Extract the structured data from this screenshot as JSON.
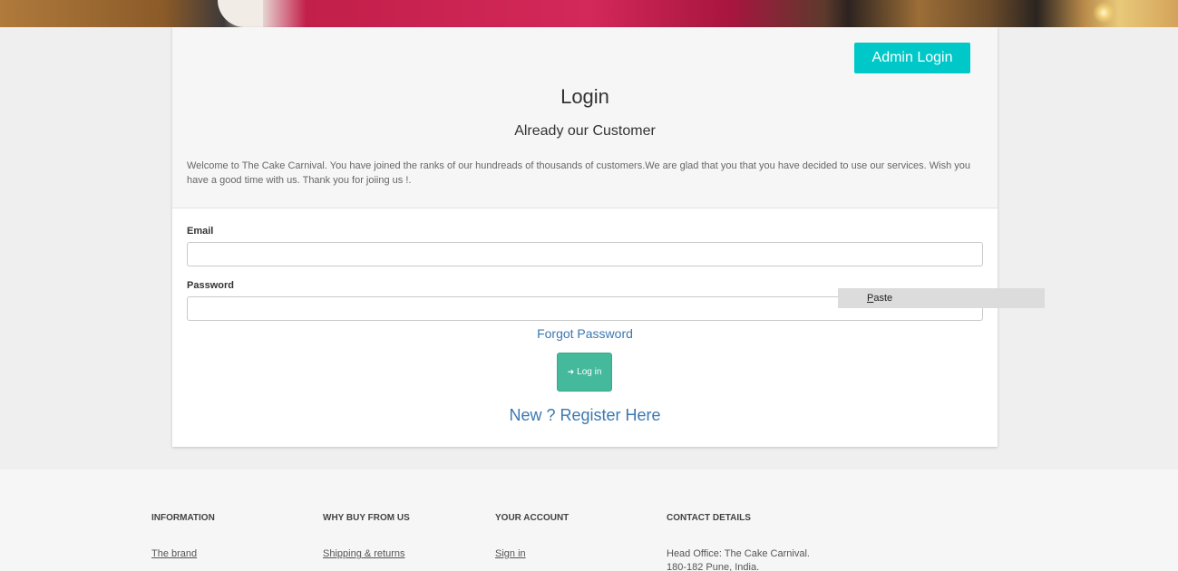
{
  "admin_login_label": "Admin Login",
  "login": {
    "title": "Login",
    "subtitle": "Already our Customer",
    "welcome": "Welcome to The Cake Carnival. You have joined the ranks of our hundreads of thousands of customers.We are glad that you that you have decided to use our services. Wish you have a good time with us. Thank you for joiing us !.",
    "email_label": "Email",
    "email_value": "",
    "password_label": "Password",
    "password_value": "",
    "forgot_label": "Forgot Password",
    "login_button_label": "Log in",
    "login_icon": "sign-in-icon",
    "register_label": "New ? Register Here"
  },
  "context_menu": {
    "paste_prefix": "",
    "paste_underlined": "P",
    "paste_rest": "aste"
  },
  "footer": {
    "columns": [
      {
        "heading": "Information",
        "items": [
          "The brand"
        ]
      },
      {
        "heading": "Why buy from us",
        "items": [
          "Shipping & returns"
        ]
      },
      {
        "heading": "Your account",
        "items": [
          "Sign in"
        ]
      },
      {
        "heading": "Contact details",
        "items": [
          "Head Office: The Cake Carnival.",
          "180-182 Pune, India."
        ]
      }
    ]
  },
  "colors": {
    "admin_button": "#00c8c8",
    "login_button": "#45b99c",
    "link": "#3b78b0"
  }
}
